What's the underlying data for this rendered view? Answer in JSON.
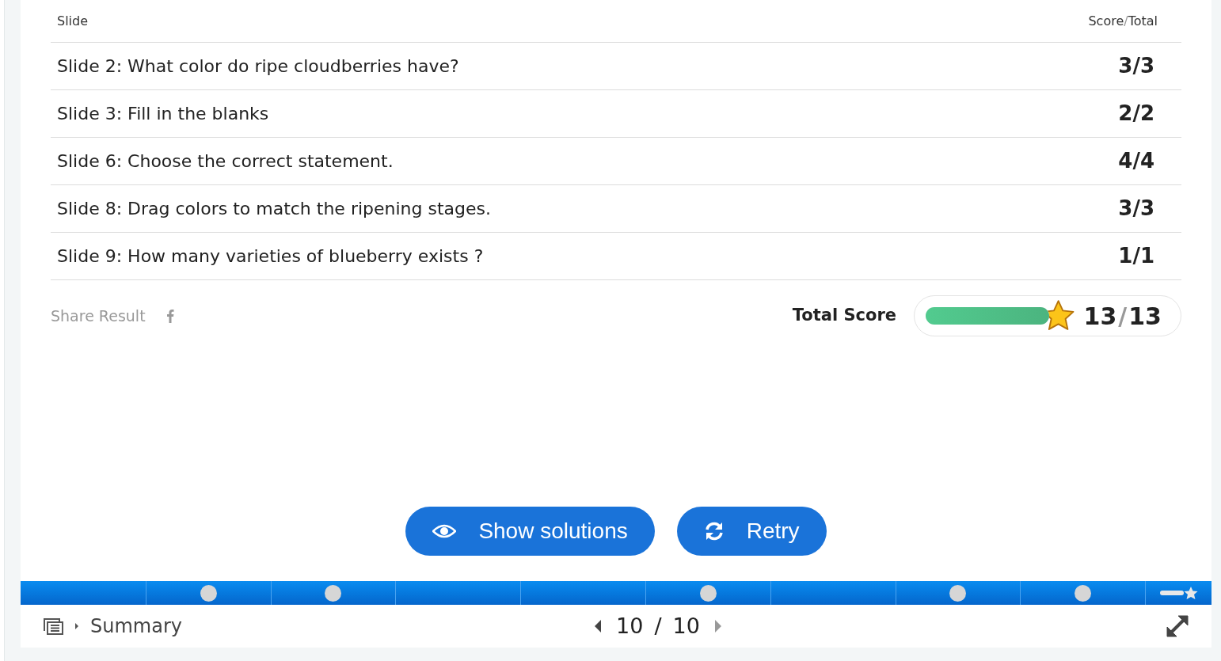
{
  "table": {
    "columns": [
      "Slide",
      "Score",
      "/",
      "Total"
    ],
    "rows": [
      {
        "slide": "Slide 2: What color do ripe cloudberries have?",
        "score": "3/3"
      },
      {
        "slide": "Slide 3: Fill in the blanks",
        "score": "2/2"
      },
      {
        "slide": "Slide 6: Choose the correct statement.",
        "score": "4/4"
      },
      {
        "slide": "Slide 8: Drag colors to match the ripening stages.",
        "score": "3/3"
      },
      {
        "slide": "Slide 9: How many varieties of blueberry exists ?",
        "score": "1/1"
      }
    ]
  },
  "share": {
    "label": "Share Result"
  },
  "total": {
    "label": "Total Score",
    "level": 1,
    "score": "13",
    "separator": "/",
    "max": "13"
  },
  "buttons": [
    {
      "kind": "solutions",
      "label": "Show solutions"
    },
    {
      "kind": "retry",
      "label": "Retry"
    }
  ],
  "progress": [
    {
      "kind": "slide",
      "answered": false
    },
    {
      "kind": "slide",
      "answered": true
    },
    {
      "kind": "slide",
      "answered": true
    },
    {
      "kind": "slide",
      "answered": false
    },
    {
      "kind": "slide",
      "answered": false
    },
    {
      "kind": "slide",
      "answered": true
    },
    {
      "kind": "slide",
      "answered": false
    },
    {
      "kind": "slide",
      "answered": true
    },
    {
      "kind": "slide",
      "answered": true
    },
    {
      "kind": "summary"
    }
  ],
  "footer": {
    "title": "Summary",
    "current": "10",
    "separator": "/",
    "total": "10"
  }
}
